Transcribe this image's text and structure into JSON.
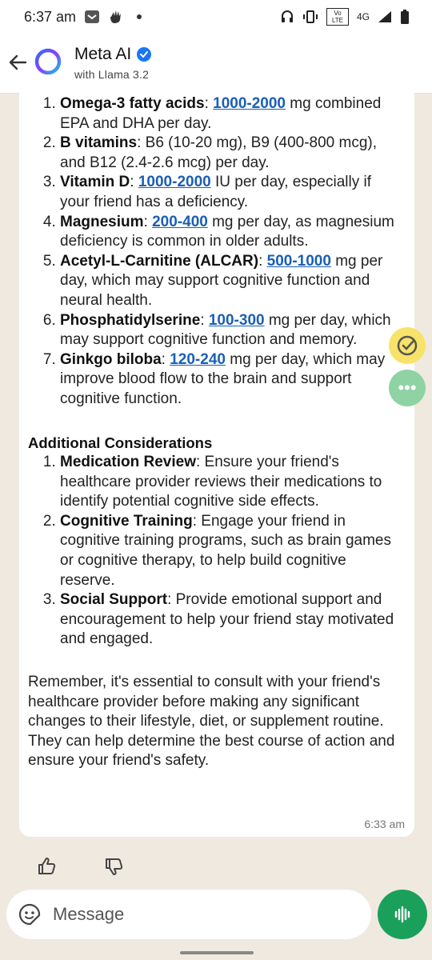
{
  "status_bar": {
    "time": "6:37 am",
    "network": "4G",
    "volte": "Vo LTE"
  },
  "header": {
    "title": "Meta AI",
    "subtitle": "with Llama 3.2"
  },
  "supplements": [
    {
      "num": "1.",
      "name": "Omega-3 fatty acids",
      "sep": ": ",
      "dose": "1000-2000",
      "rest": " mg combined EPA and DHA per day."
    },
    {
      "num": "2.",
      "name": "B vitamins",
      "sep": ": ",
      "dose": "",
      "rest": "B6 (10-20 mg), B9 (400-800 mcg), and B12 (2.4-2.6 mcg) per day."
    },
    {
      "num": "3.",
      "name": "Vitamin D",
      "sep": ": ",
      "dose": "1000-2000",
      "rest": " IU per day, especially if your friend has a deficiency."
    },
    {
      "num": "4.",
      "name": "Magnesium",
      "sep": ": ",
      "dose": "200-400",
      "rest": " mg per day, as magnesium deficiency is common in older adults."
    },
    {
      "num": "5.",
      "name": "Acetyl-L-Carnitine (ALCAR)",
      "sep": ": ",
      "dose": "500-1000",
      "rest": " mg per day, which may support cognitive function and neural health."
    },
    {
      "num": "6.",
      "name": "Phosphatidylserine",
      "sep": ": ",
      "dose": "100-300",
      "rest": " mg per day, which may support cognitive function and memory."
    },
    {
      "num": "7.",
      "name": "Ginkgo biloba",
      "sep": ": ",
      "dose": "120-240",
      "rest": " mg per day, which may improve blood flow to the brain and support cognitive function."
    }
  ],
  "considerations_heading": "Additional Considerations",
  "considerations": [
    {
      "num": "1.",
      "name": "Medication Review",
      "rest": ": Ensure your friend's healthcare provider reviews their medications to identify potential cognitive side effects."
    },
    {
      "num": "2.",
      "name": "Cognitive Training",
      "rest": ": Engage your friend in cognitive training programs, such as brain games or cognitive therapy, to help build cognitive reserve."
    },
    {
      "num": "3.",
      "name": "Social Support",
      "rest": ": Provide emotional support and encouragement to help your friend stay motivated and engaged."
    }
  ],
  "closing": "Remember, it's essential to consult with your friend's healthcare provider before making any significant changes to their lifestyle, diet, or supplement routine. They can help determine the best course of action and ensure your friend's safety.",
  "message_time": "6:33 am",
  "composer": {
    "placeholder": "Message"
  },
  "colors": {
    "link": "#1a5fb4",
    "mic": "#1aa05a",
    "check_fab": "#f7e36a",
    "more_fab": "#8fd3a4",
    "chat_bg": "#efe9df"
  },
  "icons": [
    "back-arrow-icon",
    "meta-ai-logo-icon",
    "verified-badge-icon",
    "thumbs-up-icon",
    "thumbs-down-icon",
    "emoji-sticker-icon",
    "voice-icon",
    "check-icon",
    "more-icon"
  ]
}
